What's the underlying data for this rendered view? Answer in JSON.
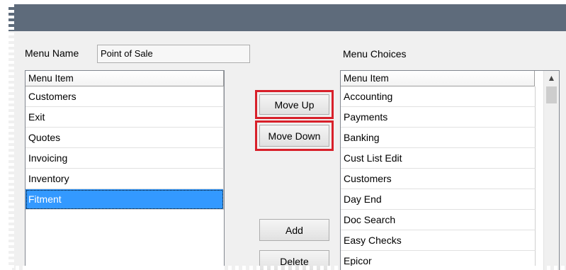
{
  "menu_name": {
    "label": "Menu Name",
    "value": "Point of Sale"
  },
  "menu_choices": {
    "label": "Menu Choices"
  },
  "left_list": {
    "header": "Menu Item",
    "items": [
      "Customers",
      "Exit",
      "Quotes",
      "Invoicing",
      "Inventory",
      "Fitment"
    ],
    "selected": "Fitment"
  },
  "right_list": {
    "header": "Menu Item",
    "items": [
      "Accounting",
      "Payments",
      "Banking",
      "Cust List Edit",
      "Customers",
      "Day End",
      "Doc Search",
      "Easy Checks",
      "Epicor"
    ]
  },
  "buttons": {
    "move_up": "Move Up",
    "move_down": "Move Down",
    "add": "Add",
    "delete": "Delete"
  },
  "colors": {
    "titlebar": "#5e6b7b",
    "selection": "#3399ff",
    "highlight": "#d8202a"
  },
  "icons": {
    "scroll_up": "chevron-up-icon"
  }
}
